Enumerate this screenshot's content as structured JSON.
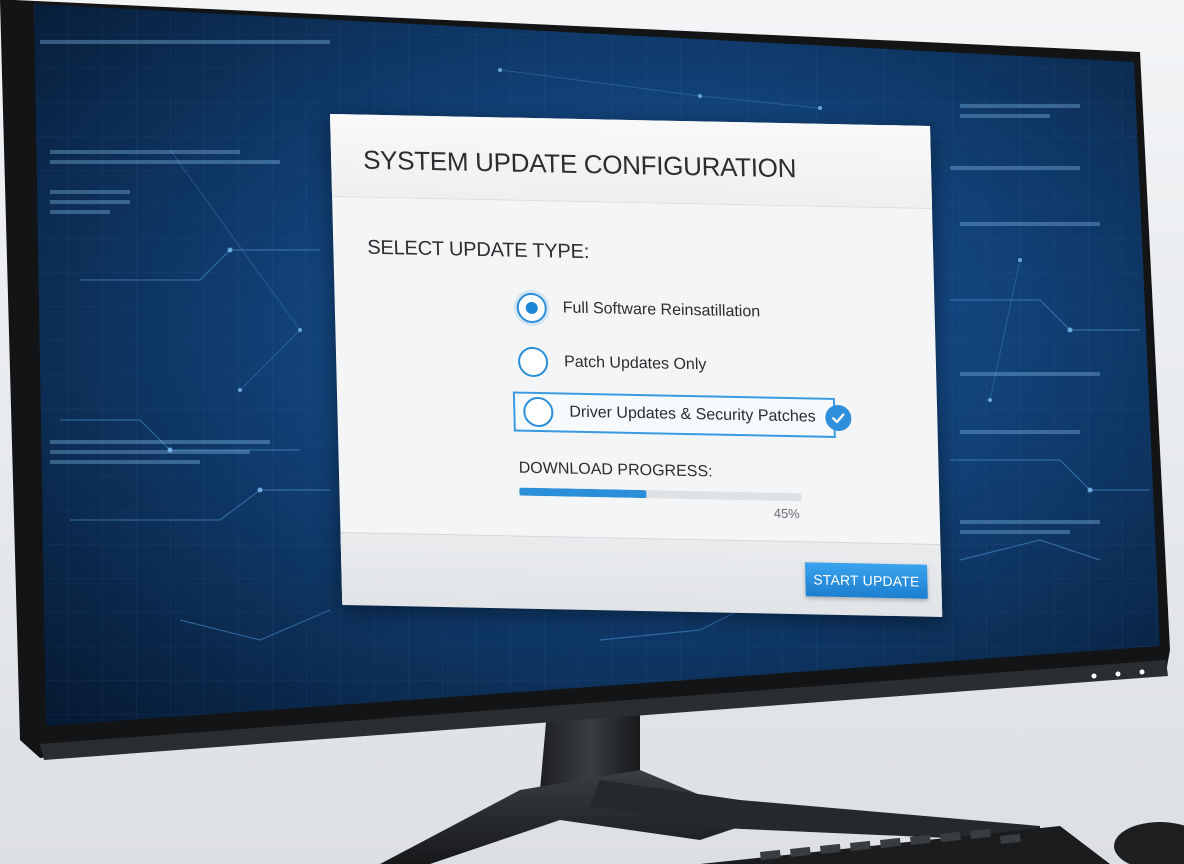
{
  "dialog": {
    "title": "SYSTEM UPDATE CONFIGURATION",
    "section_label": "SELECT UPDATE TYPE:",
    "options": [
      {
        "label": "Full Software Reinsatillation",
        "selected": true
      },
      {
        "label": "Patch Updates Only",
        "selected": false
      },
      {
        "label": "Driver Updates & Security Patches",
        "selected": false,
        "checked": true
      }
    ],
    "progress": {
      "label": "DOWNLOAD PROGRESS:",
      "percent_text": "45%",
      "value": 0.45
    },
    "start_button_label": "START UPDATE"
  },
  "colors": {
    "accent": "#2a8fd8",
    "screen_background": "#0d3561",
    "dialog_background": "#f4f5f6",
    "button": "#1e86d6"
  },
  "icons": {
    "radio_selected": "radio-selected-icon",
    "radio_unselected": "radio-unselected-icon",
    "check": "checkmark-icon"
  }
}
